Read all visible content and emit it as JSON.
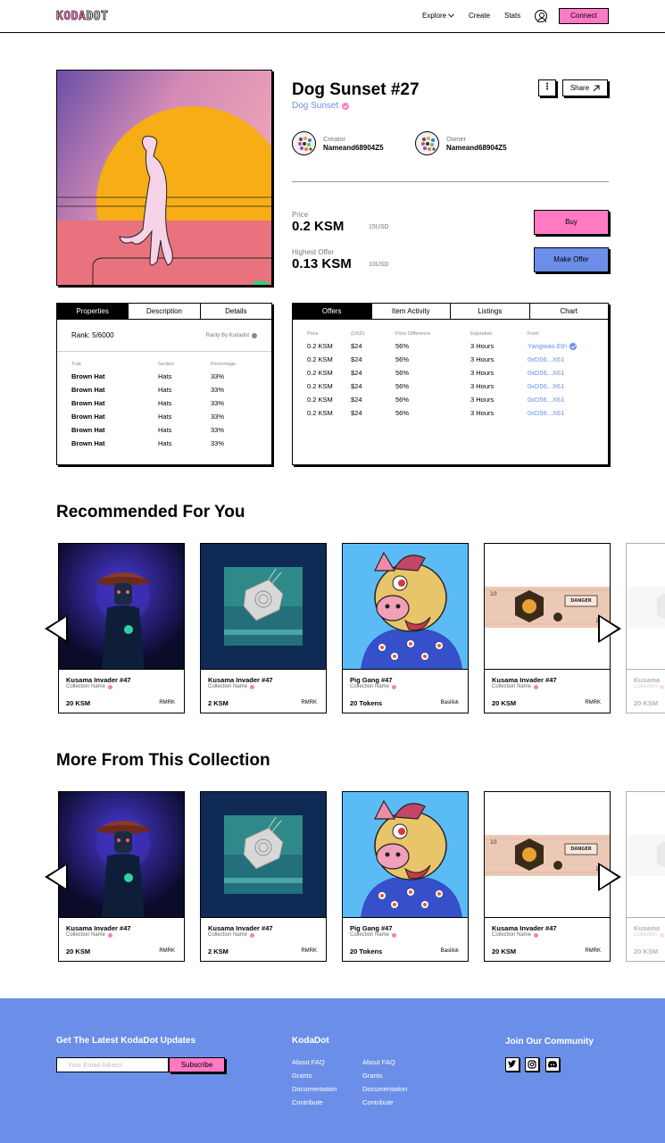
{
  "header": {
    "logo_part1": "KODA",
    "logo_part2": "DOT",
    "nav": {
      "explore": "Explore",
      "create": "Create",
      "stats": "Stats"
    },
    "connect": "Connect"
  },
  "nft": {
    "title": "Dog Sunset #27",
    "collection": "Dog Sunset",
    "share": "Share",
    "creator_label": "Creator",
    "creator_name": "Nameand68904Z5",
    "owner_label": "Owner",
    "owner_name": "Nameand68904Z5",
    "price_label": "Price",
    "price": "0.2 KSM",
    "price_usd": "15USD",
    "offer_label": "Highest Offer",
    "offer": "0.13 KSM",
    "offer_usd": "10USD",
    "buy": "Buy",
    "make_offer": "Make Offer"
  },
  "properties": {
    "tabs": [
      "Properties",
      "Description",
      "Details"
    ],
    "rank": "Rank: 5/6000",
    "rarity": "Rarity By Kodadot",
    "columns": [
      "Trait",
      "Section",
      "Percentage"
    ],
    "rows": [
      [
        "Brown Hat",
        "Hats",
        "33%"
      ],
      [
        "Brown Hat",
        "Hats",
        "33%"
      ],
      [
        "Brown Hat",
        "Hats",
        "33%"
      ],
      [
        "Brown Hat",
        "Hats",
        "33%"
      ],
      [
        "Brown Hat",
        "Hats",
        "33%"
      ],
      [
        "Brown Hat",
        "Hats",
        "33%"
      ]
    ]
  },
  "offers": {
    "tabs": [
      "Offers",
      "Item Activity",
      "Listings",
      "Chart"
    ],
    "columns": [
      "Price",
      "(USD)",
      "Floor Difference",
      "Expiration",
      "From"
    ],
    "rows": [
      [
        "0.2 KSM",
        "$24",
        "56%",
        "3 Hours",
        "Yangwao.Eth"
      ],
      [
        "0.2 KSM",
        "$24",
        "56%",
        "3 Hours",
        "0xD56...X61"
      ],
      [
        "0.2 KSM",
        "$24",
        "56%",
        "3 Hours",
        "0xD56...X61"
      ],
      [
        "0.2 KSM",
        "$24",
        "56%",
        "3 Hours",
        "0xD56...X61"
      ],
      [
        "0.2 KSM",
        "$24",
        "56%",
        "3 Hours",
        "0xD56...X61"
      ],
      [
        "0.2 KSM",
        "$24",
        "56%",
        "3 Hours",
        "0xD56...X61"
      ]
    ]
  },
  "recommended": {
    "title": "Recommended For You",
    "cards": [
      {
        "name": "Kusama Invader #47",
        "collection": "Collection Name",
        "price": "20 KSM",
        "chain": "RMRK"
      },
      {
        "name": "Kusama Invader #47",
        "collection": "Collection Name",
        "price": "2 KSM",
        "chain": "RMRK"
      },
      {
        "name": "Pig Gang #47",
        "collection": "Collection Name",
        "price": "20 Tokens",
        "chain": "Basilisk"
      },
      {
        "name": "Kusama Invader #47",
        "collection": "Collection Name",
        "price": "20 KSM",
        "chain": "RMRK"
      },
      {
        "name": "Kusama",
        "collection": "Collection",
        "price": "20 KSM",
        "chain": ""
      }
    ]
  },
  "more": {
    "title": "More From This Collection",
    "cards": [
      {
        "name": "Kusama Invader #47",
        "collection": "Collection Name",
        "price": "20 KSM",
        "chain": "RMRK"
      },
      {
        "name": "Kusama Invader #47",
        "collection": "Collection Name",
        "price": "2 KSM",
        "chain": "RMRK"
      },
      {
        "name": "Pig Gang #47",
        "collection": "Collection Name",
        "price": "20 Tokens",
        "chain": "Basilisk"
      },
      {
        "name": "Kusama Invader #47",
        "collection": "Collection Name",
        "price": "20 KSM",
        "chain": "RMRK"
      },
      {
        "name": "Kusama",
        "collection": "Collection",
        "price": "20 KSM",
        "chain": ""
      }
    ]
  },
  "footer": {
    "newsletter_title": "Get The Latest KodaDot Updates",
    "email_placeholder": "Your Email Adress",
    "subscribe": "Subscribe",
    "kodadot_title": "KodaDot",
    "links_col1": [
      "About FAQ",
      "Grants",
      "Documentation",
      "Contribute"
    ],
    "links_col2": [
      "About FAQ",
      "Grants",
      "Documentation",
      "Contribute"
    ],
    "community_title": "Join Our Community",
    "socials": [
      "twitter-icon",
      "instagram-icon",
      "discord-icon"
    ]
  },
  "colors": {
    "pink": "#ff7ac3",
    "blue": "#6b8fe8"
  }
}
